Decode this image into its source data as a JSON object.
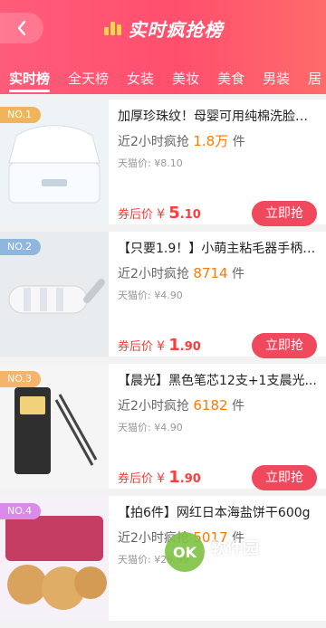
{
  "header": {
    "title": "实时疯抢榜",
    "tabs": [
      "实时榜",
      "全天榜",
      "女装",
      "美妆",
      "美食",
      "男装",
      "居"
    ]
  },
  "products": [
    {
      "badge": "NO.1",
      "badge_color": "#f0b55b",
      "name": "加厚珍珠纹！母婴可用纯棉洗脸巾...",
      "stat_prefix": "近2小时疯抢",
      "stat_value": "1.8万",
      "stat_suffix": "件",
      "mall_price": "天猫价: ¥8.10",
      "after_label": "券后价",
      "after_yen": "¥",
      "after_price_int": "5",
      "after_price_dec": ".10",
      "button": "立即抢"
    },
    {
      "badge": "NO.2",
      "badge_color": "#8fb6dd",
      "name": "【只要1.9！】小萌主粘毛器手柄+...",
      "stat_prefix": "近2小时疯抢",
      "stat_value": "8714",
      "stat_suffix": "件",
      "mall_price": "天猫价: ¥4.90",
      "after_label": "券后价",
      "after_yen": "¥",
      "after_price_int": "1",
      "after_price_dec": ".90",
      "button": "立即抢"
    },
    {
      "badge": "NO.3",
      "badge_color": "#f5b36b",
      "name": "【晨光】黑色笔芯12支+1支晨光...",
      "stat_prefix": "近2小时疯抢",
      "stat_value": "6182",
      "stat_suffix": "件",
      "mall_price": "天猫价: ¥4.90",
      "after_label": "券后价",
      "after_yen": "¥",
      "after_price_int": "1",
      "after_price_dec": ".90",
      "button": "立即抢"
    },
    {
      "badge": "NO.4",
      "badge_color": "#d88be7",
      "name": "【拍6件】网红日本海盐饼干600g",
      "stat_prefix": "近2小时疯抢",
      "stat_value": "5017",
      "stat_suffix": "件",
      "mall_price": "天猫价: ¥29.99",
      "after_label": "",
      "after_yen": "",
      "after_price_int": "",
      "after_price_dec": "",
      "button": ""
    }
  ],
  "watermark": {
    "logo": "OK",
    "text": "软件园",
    "sub": "www.okemu.com"
  }
}
